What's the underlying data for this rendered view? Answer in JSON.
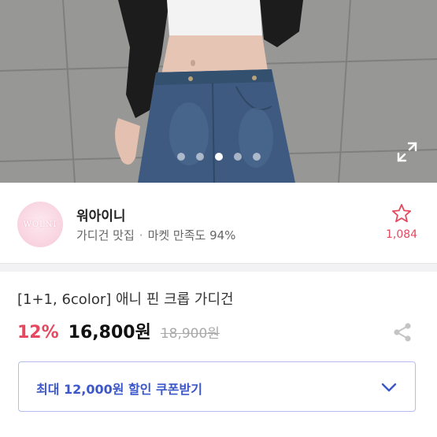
{
  "hero": {
    "pager_count": 5,
    "active_index": 2
  },
  "seller": {
    "logo_text": "WOLNI",
    "name": "워아이니",
    "tagline": "가디건 맛집",
    "separator": "·",
    "satisfaction": "마켓 만족도 94%",
    "favorite_count": "1,084"
  },
  "product": {
    "title": "[1+1, 6color] 애니 핀 크롭 가디건",
    "discount": "12%",
    "price": "16,800원",
    "original_price": "18,900원"
  },
  "coupon": {
    "label": "최대 12,000원 할인 쿠폰받기"
  },
  "colors": {
    "accent_red": "#e5485f",
    "coupon_blue": "#3b57c9"
  }
}
